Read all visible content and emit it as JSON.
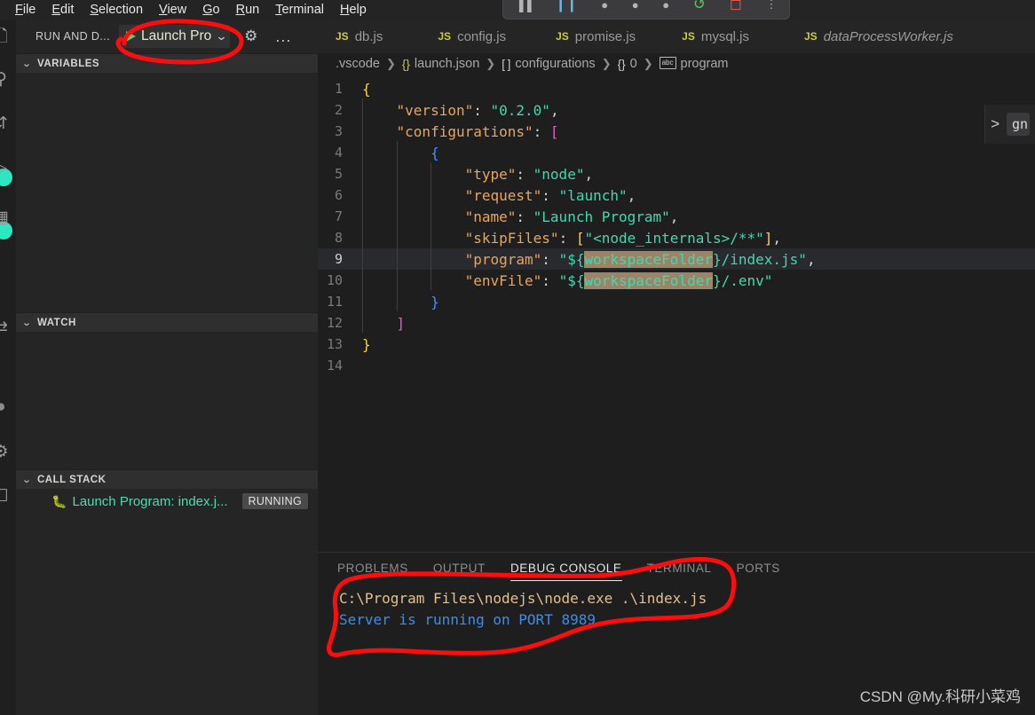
{
  "menubar": {
    "items": [
      {
        "label": "File",
        "mnemonic": "F"
      },
      {
        "label": "Edit",
        "mnemonic": "E"
      },
      {
        "label": "Selection",
        "mnemonic": "S"
      },
      {
        "label": "View",
        "mnemonic": "V"
      },
      {
        "label": "Go",
        "mnemonic": "G"
      },
      {
        "label": "Run",
        "mnemonic": "R"
      },
      {
        "label": "Terminal",
        "mnemonic": "T"
      },
      {
        "label": "Help",
        "mnemonic": "H"
      }
    ]
  },
  "activitybar": {
    "icons": [
      "explorer-icon",
      "search-icon",
      "source-control-icon",
      "run-debug-icon",
      "extensions-icon",
      "remote-icon",
      "account-icon",
      "settings-gear-icon",
      "test-icon"
    ]
  },
  "sidebar": {
    "title": "RUN AND D...",
    "config": {
      "play_icon": "play-icon",
      "name": "Launch Pro",
      "chevron": "chevron-down-icon",
      "gear": "gear-icon",
      "more": "..."
    },
    "sections": [
      {
        "label": "VARIABLES",
        "collapsed": false
      },
      {
        "label": "WATCH",
        "collapsed": false
      },
      {
        "label": "CALL STACK",
        "collapsed": false
      }
    ],
    "callstack": {
      "icon": "bug-icon",
      "label": "Launch Program: index.j...",
      "status": "RUNNING"
    }
  },
  "editor": {
    "tabs": [
      {
        "icon": "js-file-icon",
        "badge": "JS",
        "name": "db.js",
        "preview": false
      },
      {
        "icon": "js-file-icon",
        "badge": "JS",
        "name": "config.js",
        "preview": false
      },
      {
        "icon": "js-file-icon",
        "badge": "JS",
        "name": "promise.js",
        "preview": false
      },
      {
        "icon": "js-file-icon",
        "badge": "JS",
        "name": "mysql.js",
        "preview": false
      },
      {
        "icon": "js-file-icon",
        "badge": "JS",
        "name": "dataProcessWorker.js",
        "preview": true
      }
    ],
    "breadcrumb": [
      {
        "text": ".vscode",
        "kind": "folder"
      },
      {
        "text": "launch.json",
        "kind": "json"
      },
      {
        "text": "configurations",
        "kind": "array"
      },
      {
        "text": "0",
        "kind": "object"
      },
      {
        "text": "program",
        "kind": "string"
      }
    ],
    "active_line": 9,
    "lines": [
      {
        "n": "1",
        "indent": 0
      },
      {
        "n": "2",
        "indent": 1
      },
      {
        "n": "3",
        "indent": 1
      },
      {
        "n": "4",
        "indent": 2
      },
      {
        "n": "5",
        "indent": 3
      },
      {
        "n": "6",
        "indent": 3
      },
      {
        "n": "7",
        "indent": 3
      },
      {
        "n": "8",
        "indent": 3
      },
      {
        "n": "9",
        "indent": 3
      },
      {
        "n": "10",
        "indent": 3
      },
      {
        "n": "11",
        "indent": 2
      },
      {
        "n": "12",
        "indent": 1
      },
      {
        "n": "13",
        "indent": 0
      },
      {
        "n": "14",
        "indent": 0
      }
    ],
    "source": {
      "version_key": "\"version\"",
      "version_val": "\"0.2.0\"",
      "configurations_key": "\"configurations\"",
      "type_key": "\"type\"",
      "type_val": "\"node\"",
      "request_key": "\"request\"",
      "request_val": "\"launch\"",
      "name_key": "\"name\"",
      "name_val": "\"Launch Program\"",
      "skipfiles_key": "\"skipFiles\"",
      "skipfiles_val": "\"<node_internals>/**\"",
      "program_key": "\"program\"",
      "program_prefix": "\"${",
      "program_var": "workspaceFolder",
      "program_suffix": "}/index.js\"",
      "envfile_key": "\"envFile\"",
      "envfile_prefix": "\"${",
      "envfile_var": "workspaceFolder",
      "envfile_suffix": "}/.env\""
    },
    "right_widget": {
      "chevron": ">",
      "text": "gn"
    }
  },
  "debug_toolbar": {
    "buttons": [
      "continue-icon",
      "pause-icon",
      "step-over-icon",
      "step-into-icon",
      "step-out-icon",
      "restart-icon",
      "stop-icon",
      "more-icon"
    ]
  },
  "panel": {
    "tabs": [
      {
        "label": "PROBLEMS",
        "active": false
      },
      {
        "label": "OUTPUT",
        "active": false
      },
      {
        "label": "DEBUG CONSOLE",
        "active": true
      },
      {
        "label": "TERMINAL",
        "active": false
      },
      {
        "label": "PORTS",
        "active": false
      }
    ],
    "console_lines": [
      {
        "text": "C:\\Program Files\\nodejs\\node.exe .\\index.js",
        "kind": "command"
      },
      {
        "text": "Server is running on PORT 8989",
        "kind": "log"
      }
    ]
  },
  "watermark": {
    "text": "CSDN @My.科研小菜鸡"
  },
  "colors": {
    "annotation": "#fd0d0d",
    "json_key": "#e8a55e",
    "json_string": "#3fd9b0",
    "bracket_l1": "#f5d44c",
    "bracket_l2": "#e060c0",
    "bracket_l3": "#3794ff",
    "highlight": "#9c8466",
    "console_command": "#e3c08d",
    "console_log": "#3b8eea",
    "callstack_label": "#4ddcb0",
    "play_green": "#6cc26c"
  }
}
